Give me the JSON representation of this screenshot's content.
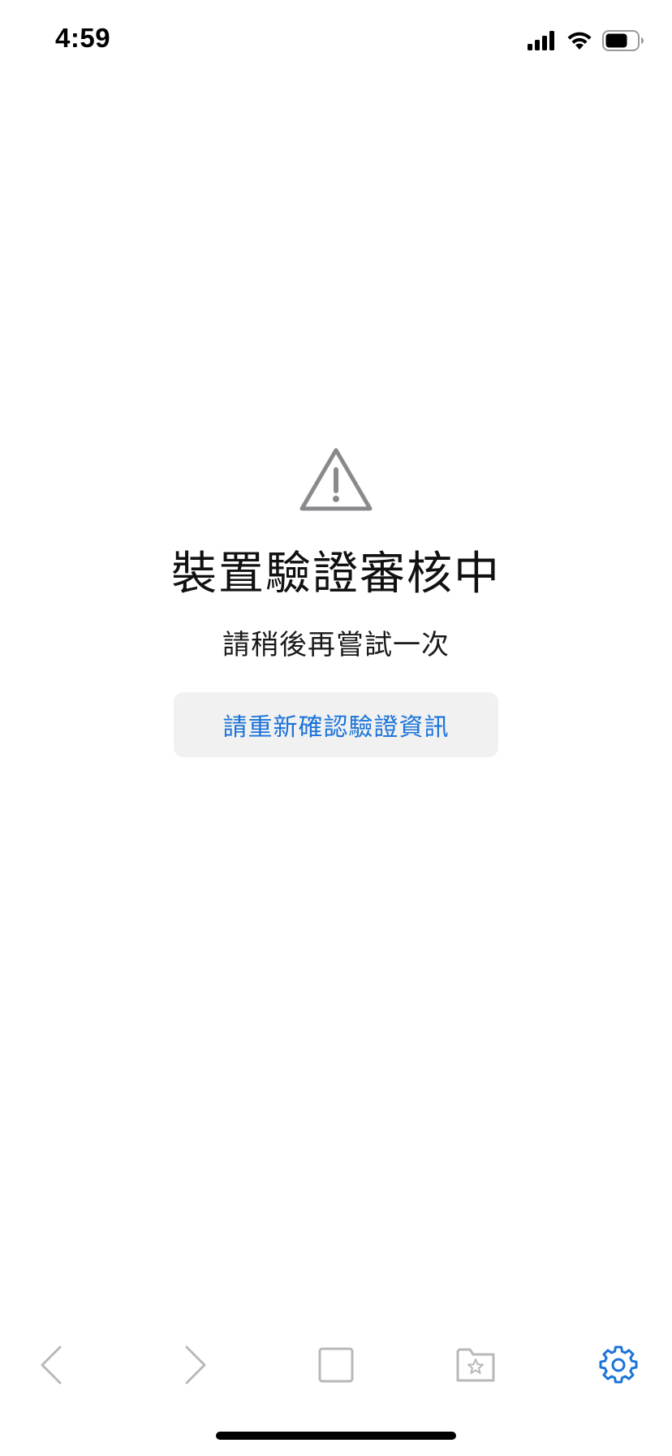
{
  "status_bar": {
    "time": "4:59",
    "icons": [
      "cellular-signal-icon",
      "wifi-icon",
      "battery-icon"
    ]
  },
  "message": {
    "icon": "warning-triangle-icon",
    "title": "裝置驗證審核中",
    "subtitle": "請稍後再嘗試一次",
    "button_label": "請重新確認驗證資訊"
  },
  "toolbar": {
    "items": [
      {
        "icon": "back-chevron-icon",
        "enabled": false
      },
      {
        "icon": "forward-chevron-icon",
        "enabled": false
      },
      {
        "icon": "tabs-square-icon",
        "enabled": false
      },
      {
        "icon": "bookmark-folder-icon",
        "enabled": false
      },
      {
        "icon": "gear-icon",
        "enabled": true
      }
    ]
  },
  "colors": {
    "accent": "#1a73d9",
    "disabled_icon": "#b8b8bc",
    "warning_icon": "#8a8a8e",
    "button_bg": "#f1f1f2"
  }
}
